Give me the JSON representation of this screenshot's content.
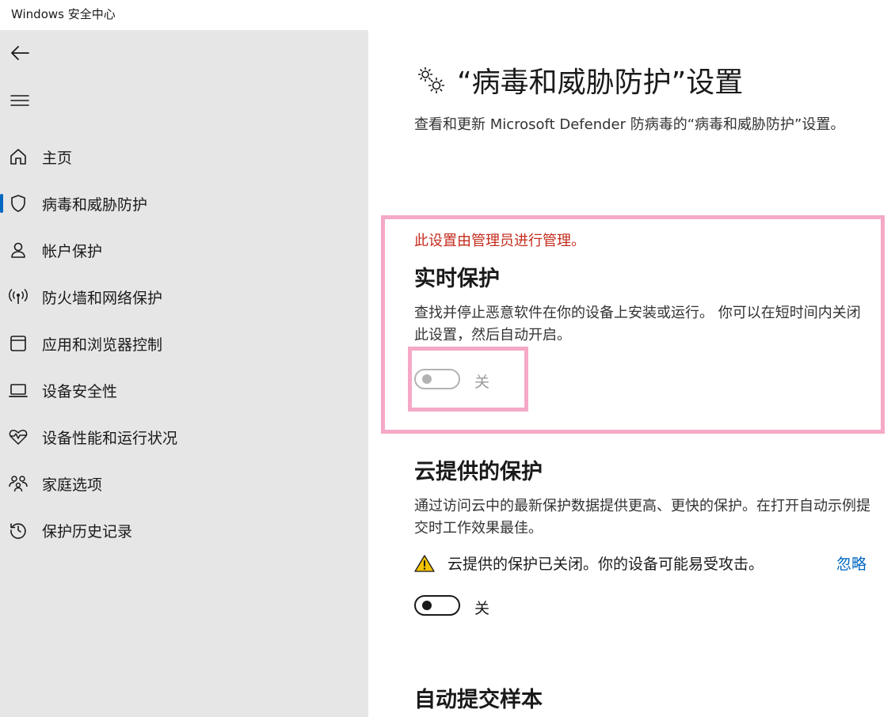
{
  "window": {
    "title": "Windows 安全中心"
  },
  "sidebar": {
    "items": [
      {
        "label": "主页",
        "icon": "home-icon"
      },
      {
        "label": "病毒和威胁防护",
        "icon": "shield-icon",
        "active": true
      },
      {
        "label": "帐户保护",
        "icon": "person-icon"
      },
      {
        "label": "防火墙和网络保护",
        "icon": "wireless-antenna-icon"
      },
      {
        "label": "应用和浏览器控制",
        "icon": "app-window-icon"
      },
      {
        "label": "设备安全性",
        "icon": "laptop-icon"
      },
      {
        "label": "设备性能和运行状况",
        "icon": "heart-pulse-icon"
      },
      {
        "label": "家庭选项",
        "icon": "family-icon"
      },
      {
        "label": "保护历史记录",
        "icon": "history-icon"
      }
    ]
  },
  "main": {
    "title": "“病毒和威胁防护”设置",
    "description": "查看和更新 Microsoft Defender 防病毒的“病毒和威胁防护”设置。",
    "realtime": {
      "admin_note": "此设置由管理员进行管理。",
      "title": "实时保护",
      "description": "查找并停止恶意软件在你的设备上安装或运行。 你可以在短时间内关闭此设置，然后自动开启。",
      "toggle_state": "关"
    },
    "cloud": {
      "title": "云提供的保护",
      "description": "通过访问云中的最新保护数据提供更高、更快的保护。在打开自动示例提交时工作效果最佳。",
      "warning": "云提供的保护已关闭。你的设备可能易受攻击。",
      "ignore_link": "忽略",
      "toggle_state": "关"
    },
    "auto_sample": {
      "title": "自动提交样本"
    }
  },
  "colors": {
    "accent": "#0067c0",
    "admin_note": "#c42b1c",
    "highlight_border": "#f5a9c6",
    "warning": "#f2c200",
    "sidebar_bg": "#e6e6e6"
  }
}
